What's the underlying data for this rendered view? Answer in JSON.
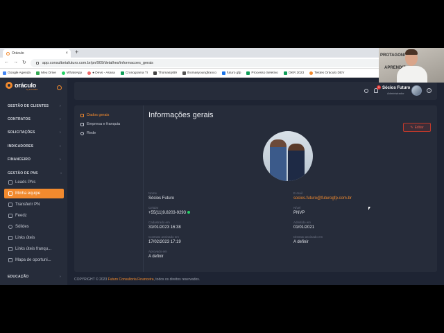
{
  "browser": {
    "tab_title": "Oráculo",
    "new_tab": "+",
    "close": "×",
    "url": "app.consultoriafuturo.com.br/pn/909/detalhes/informacoes_gerais",
    "bookmarks": [
      {
        "label": "Google Agenda",
        "color": "#4285f4"
      },
      {
        "label": "Meu Drive",
        "color": "#34a853"
      },
      {
        "label": "WhatsApp",
        "color": "#25d366"
      },
      {
        "label": "● Devs - Asana",
        "color": "#f06a6a"
      },
      {
        "label": "Cronograma TI",
        "color": "#0f9d58"
      },
      {
        "label": "Thomas/yB9",
        "color": "#444444"
      },
      {
        "label": "thomasyoungfranco",
        "color": "#555555"
      },
      {
        "label": "futuro gfp",
        "color": "#1a73e8"
      },
      {
        "label": "Processo Seletivo",
        "color": "#0f9d58"
      },
      {
        "label": "OKR 2023",
        "color": "#0f9d58"
      },
      {
        "label": "Testes Oráculo DEV",
        "color": "#f28a2e"
      }
    ]
  },
  "webcam": {
    "text1": "PROTAGONI",
    "text2": "APRENDIZ"
  },
  "sidebar": {
    "logo": "oráculo",
    "logo_sub": "by FUTURO",
    "sections": [
      {
        "label": "GESTÃO DE CLIENTES"
      },
      {
        "label": "CONTRATOS"
      },
      {
        "label": "SOLICITAÇÕES"
      },
      {
        "label": "INDICADORES"
      },
      {
        "label": "FINANCEIRO"
      },
      {
        "label": "GESTÃO DE PNS"
      },
      {
        "label": "EDUCAÇÃO"
      }
    ],
    "items": [
      {
        "label": "Leads PNs"
      },
      {
        "label": "Minha equipe"
      },
      {
        "label": "Transferir PN"
      },
      {
        "label": "Feedz"
      },
      {
        "label": "Sólides"
      },
      {
        "label": "Links úteis"
      },
      {
        "label": "Links úteis franqu..."
      },
      {
        "label": "Mapa de oportuni..."
      }
    ]
  },
  "topbar": {
    "user_name": "Sócios Futuro",
    "user_role": "Administrador",
    "notifications": "3",
    "help": "?"
  },
  "card": {
    "nav": [
      {
        "label": "Dados gerais"
      },
      {
        "label": "Empresa e franquia"
      },
      {
        "label": "Rede"
      }
    ],
    "title": "Informações gerais",
    "edit_label": "Editar",
    "fields": [
      {
        "label": "Nome",
        "value": "Sócios Futuro"
      },
      {
        "label": "E-mail",
        "value": "socios.futuro@futurogfp.com.br"
      },
      {
        "label": "Celular",
        "value": "+55(11)9.8203-9293"
      },
      {
        "label": "Nível",
        "value": "PNVP"
      },
      {
        "label": "Cadastrado em",
        "value": "31/01/2023 16:38"
      },
      {
        "label": "Admitido em",
        "value": "01/01/2021"
      },
      {
        "label": "Contrato assinado em",
        "value": "17/02/2023 17:19"
      },
      {
        "label": "Distrato assinado em",
        "value": "A definir"
      },
      {
        "label": "Aprovado em",
        "value": "A definir"
      }
    ]
  },
  "footer": {
    "prefix": "COPYRIGHT © 2023",
    "brand": "Futuro Consultoria Financeira",
    "suffix": ", todos os direitos reservados."
  }
}
